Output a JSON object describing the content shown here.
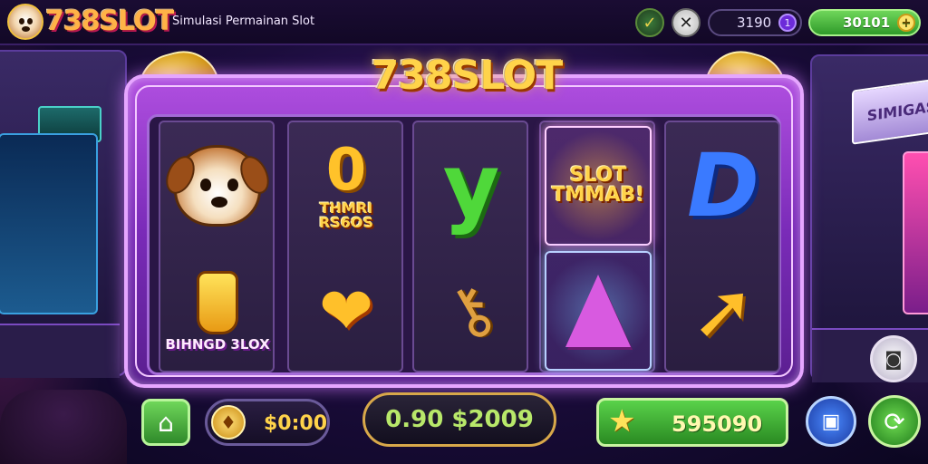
{
  "header": {
    "brand": "738SLOT",
    "subtitle": "Simulasi Permainan Slot",
    "icons": {
      "logo": "puppy-logo-icon",
      "check": "checkmark-icon",
      "close": "close-icon",
      "add": "plus-icon"
    },
    "coins": "3190",
    "coins_badge": "1",
    "cash": "30101"
  },
  "machine": {
    "title": "738SLOT",
    "reels": [
      {
        "top": {
          "icon": "puppy-icon",
          "text": ""
        },
        "bottom": {
          "icon": "bottle-icon",
          "text": "BIHNGD 3LOX"
        }
      },
      {
        "top": {
          "icon": "zero-icon",
          "glyph": "0",
          "text": "THMRI RS6OS"
        },
        "bottom": {
          "icon": "heart-fruit-icon",
          "text": ""
        }
      },
      {
        "top": {
          "icon": "y-letter-icon",
          "glyph": "y",
          "text": ""
        },
        "bottom": {
          "icon": "key-icon",
          "text": ""
        }
      },
      {
        "top": {
          "icon": "heart-icon",
          "text": "SLOT TMMAB!"
        },
        "bottom": {
          "icon": "cone-icon",
          "text": ""
        }
      },
      {
        "top": {
          "icon": "d-letter-icon",
          "glyph": "D",
          "text": ""
        },
        "bottom": {
          "icon": "arrow-icon",
          "text": ""
        }
      }
    ]
  },
  "controls": {
    "home_icon": "home-icon",
    "bet_value": "$0:00",
    "win_value": "0.90 $2009",
    "total_value": "595090",
    "camera_icon": "camera-icon",
    "spin_icon": "refresh-icon",
    "screenshot_icon": "screenshot-icon"
  },
  "background": {
    "arcade_label": "SIMIGAS"
  }
}
